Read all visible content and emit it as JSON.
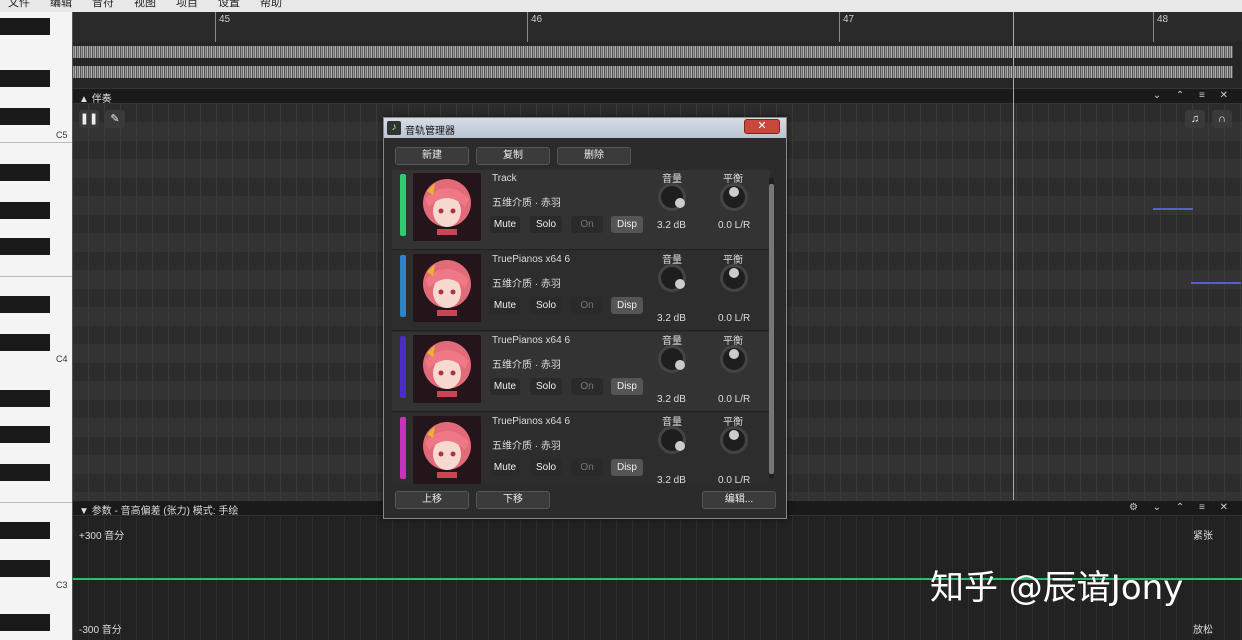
{
  "menu": [
    "文件",
    "编辑",
    "音符",
    "视图",
    "项目",
    "设置",
    "帮助"
  ],
  "timeline": {
    "markers": [
      "45",
      "46",
      "47",
      "48"
    ]
  },
  "accompaniment_panel": {
    "title": "伴奏",
    "controls": "⌄ ⌃ ≡ ✕"
  },
  "piano": {
    "labels": [
      "C5",
      "C4",
      "C3"
    ]
  },
  "params_panel": {
    "title": "参数 - 音高偏差 (张力) 模式: 手绘",
    "controls": "⚙ ⌄ ⌃ ≡ ✕",
    "top_left": "+300 音分",
    "bottom_left": "-300 音分",
    "top_right": "紧张",
    "bottom_right": "放松"
  },
  "dialog": {
    "title": "音轨管理器",
    "close": "✕",
    "buttons": {
      "new": "新建",
      "copy": "复制",
      "delete": "删除",
      "up": "上移",
      "down": "下移",
      "edit": "编辑..."
    },
    "volume_label": "音量",
    "pan_label": "平衡",
    "tracks": [
      {
        "name": "Track",
        "voice": "五维介质 · 赤羽",
        "mute": "Mute",
        "solo": "Solo",
        "on": "On",
        "disp": "Disp",
        "volume": "3.2 dB",
        "pan": "0.0 L/R",
        "color": "#2ecc71"
      },
      {
        "name": "TruePianos x64 6",
        "voice": "五维介质 · 赤羽",
        "mute": "Mute",
        "solo": "Solo",
        "on": "On",
        "disp": "Disp",
        "volume": "3.2 dB",
        "pan": "0.0 L/R",
        "color": "#2a86c8"
      },
      {
        "name": "TruePianos x64 6",
        "voice": "五维介质 · 赤羽",
        "mute": "Mute",
        "solo": "Solo",
        "on": "On",
        "disp": "Disp",
        "volume": "3.2 dB",
        "pan": "0.0 L/R",
        "color": "#4a2cc8"
      },
      {
        "name": "TruePianos x64 6",
        "voice": "五维介质 · 赤羽",
        "mute": "Mute",
        "solo": "Solo",
        "on": "On",
        "disp": "Disp",
        "volume": "3.2 dB",
        "pan": "0.0 L/R",
        "color": "#c832b4"
      }
    ]
  },
  "watermark": "知乎 @辰谙Jony"
}
